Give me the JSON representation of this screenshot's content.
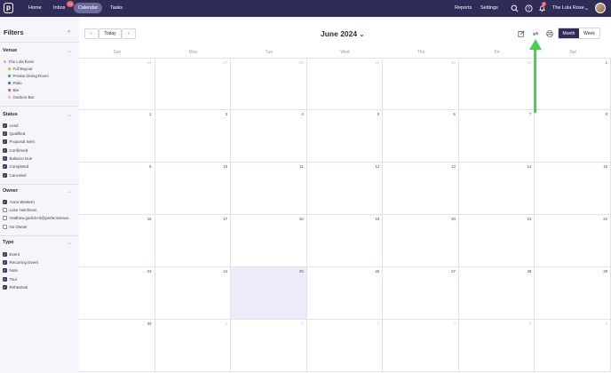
{
  "nav": {
    "logo": "p",
    "items": [
      "Home",
      "Inbox",
      "Calendar",
      "Tasks"
    ],
    "inbox_badge": "74",
    "right": {
      "reports": "Reports",
      "settings": "Settings",
      "notif_badge": "1",
      "user": "The Lola Rose"
    }
  },
  "sidebar": {
    "title": "Filters",
    "venue": {
      "label": "Venue",
      "items": [
        {
          "label": "The Lola Rose",
          "color": "#c9b1d9"
        },
        {
          "label": "Full Buyout",
          "color": "#f2a03b"
        },
        {
          "label": "Private Dining Room",
          "color": "#2fae84"
        },
        {
          "label": "Patio",
          "color": "#2e6be6"
        },
        {
          "label": "Bar",
          "color": "#e8536e"
        },
        {
          "label": "Outdoor Bar",
          "color": "#f4b8c8"
        }
      ]
    },
    "status": {
      "label": "Status",
      "items": [
        {
          "label": "Lead",
          "checked": true
        },
        {
          "label": "Qualified",
          "checked": true
        },
        {
          "label": "Proposal Sent",
          "checked": true
        },
        {
          "label": "Confirmed",
          "checked": true
        },
        {
          "label": "Balance Due",
          "checked": true
        },
        {
          "label": "Completed",
          "checked": true
        },
        {
          "label": "Canceled",
          "checked": true
        }
      ]
    },
    "owner": {
      "label": "Owner",
      "items": [
        {
          "label": "Anna Western",
          "checked": true
        },
        {
          "label": "Luke Hutchison",
          "checked": false
        },
        {
          "label": "matthew.garlick+tl@perfectvenue...",
          "checked": false
        },
        {
          "label": "No Owner",
          "checked": false
        }
      ]
    },
    "type": {
      "label": "Type",
      "items": [
        {
          "label": "Event",
          "checked": true
        },
        {
          "label": "Recurring Event",
          "checked": true
        },
        {
          "label": "Note",
          "checked": true
        },
        {
          "label": "Tour",
          "checked": true
        },
        {
          "label": "Rehearsal",
          "checked": true
        }
      ]
    }
  },
  "toolbar": {
    "today": "Today",
    "month_title": "June 2024",
    "views": [
      "Month",
      "Week"
    ],
    "active_view": "Month"
  },
  "calendar": {
    "weekdays": [
      "Sun",
      "Mon",
      "Tue",
      "Wed",
      "Thu",
      "Fri",
      "Sat"
    ],
    "weeks": [
      [
        "26",
        "27",
        "28",
        "29",
        "30",
        "31",
        "1"
      ],
      [
        "2",
        "3",
        "4",
        "5",
        "6",
        "7",
        "8"
      ],
      [
        "9",
        "10",
        "11",
        "12",
        "13",
        "14",
        "15"
      ],
      [
        "16",
        "17",
        "18",
        "19",
        "20",
        "21",
        "22"
      ],
      [
        "23",
        "24",
        "25",
        "26",
        "27",
        "28",
        "29"
      ],
      [
        "30",
        "1",
        "2",
        "3",
        "4",
        "5",
        "6"
      ]
    ],
    "today": "25"
  },
  "colors": {
    "nav_bg": "#2f2c57",
    "accent": "#2f2c57",
    "today_bg": "#ecebf9",
    "annotation_arrow": "#3fd64a"
  }
}
